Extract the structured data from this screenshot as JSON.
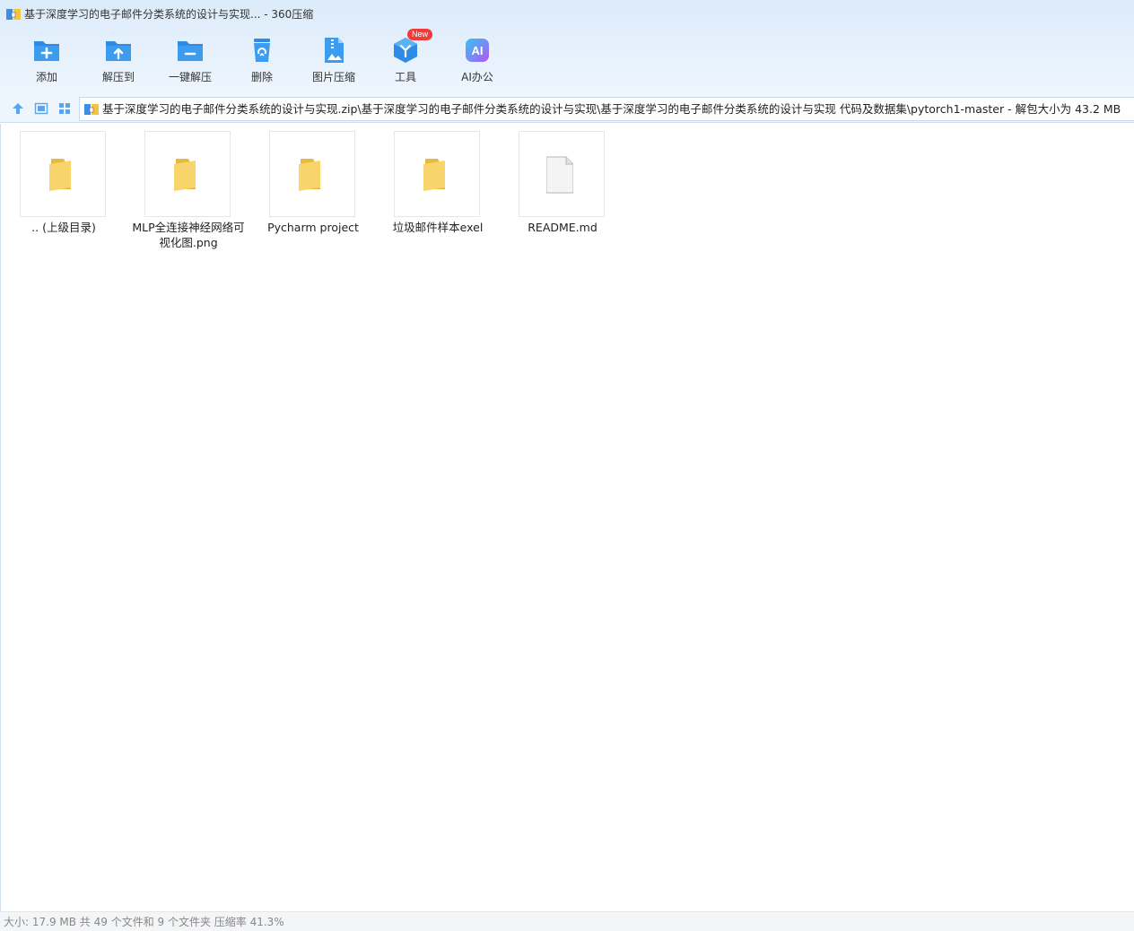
{
  "window": {
    "title": "基于深度学习的电子邮件分类系统的设计与实现... - 360压缩"
  },
  "toolbar": {
    "items": [
      {
        "label": "添加",
        "icon": "add-folder-icon"
      },
      {
        "label": "解压到",
        "icon": "extract-to-icon"
      },
      {
        "label": "一键解压",
        "icon": "one-click-extract-icon"
      },
      {
        "label": "删除",
        "icon": "trash-icon"
      },
      {
        "label": "图片压缩",
        "icon": "image-compress-icon"
      },
      {
        "label": "工具",
        "icon": "tools-cube-icon"
      },
      {
        "label": "AI办公",
        "icon": "ai-office-icon"
      }
    ],
    "new_badge": "New",
    "ai_glyph": "AI"
  },
  "address": {
    "path": "基于深度学习的电子邮件分类系统的设计与实现.zip\\基于深度学习的电子邮件分类系统的设计与实现\\基于深度学习的电子邮件分类系统的设计与实现 代码及数据集\\pytorch1-master - 解包大小为 43.2 MB"
  },
  "files": [
    {
      "name": ".. (上级目录)",
      "type": "folder"
    },
    {
      "name": "MLP全连接神经网络可视化图.png",
      "type": "folder"
    },
    {
      "name": "Pycharm project",
      "type": "folder"
    },
    {
      "name": "垃圾邮件样本exel",
      "type": "folder"
    },
    {
      "name": "README.md",
      "type": "file"
    }
  ],
  "status": {
    "text": "大小: 17.9 MB 共 49 个文件和 9 个文件夹 压缩率 41.3%"
  },
  "colors": {
    "accent_blue": "#2e8ce6",
    "folder_yellow": "#f6cf5b",
    "badge_red": "#f03b3b"
  }
}
